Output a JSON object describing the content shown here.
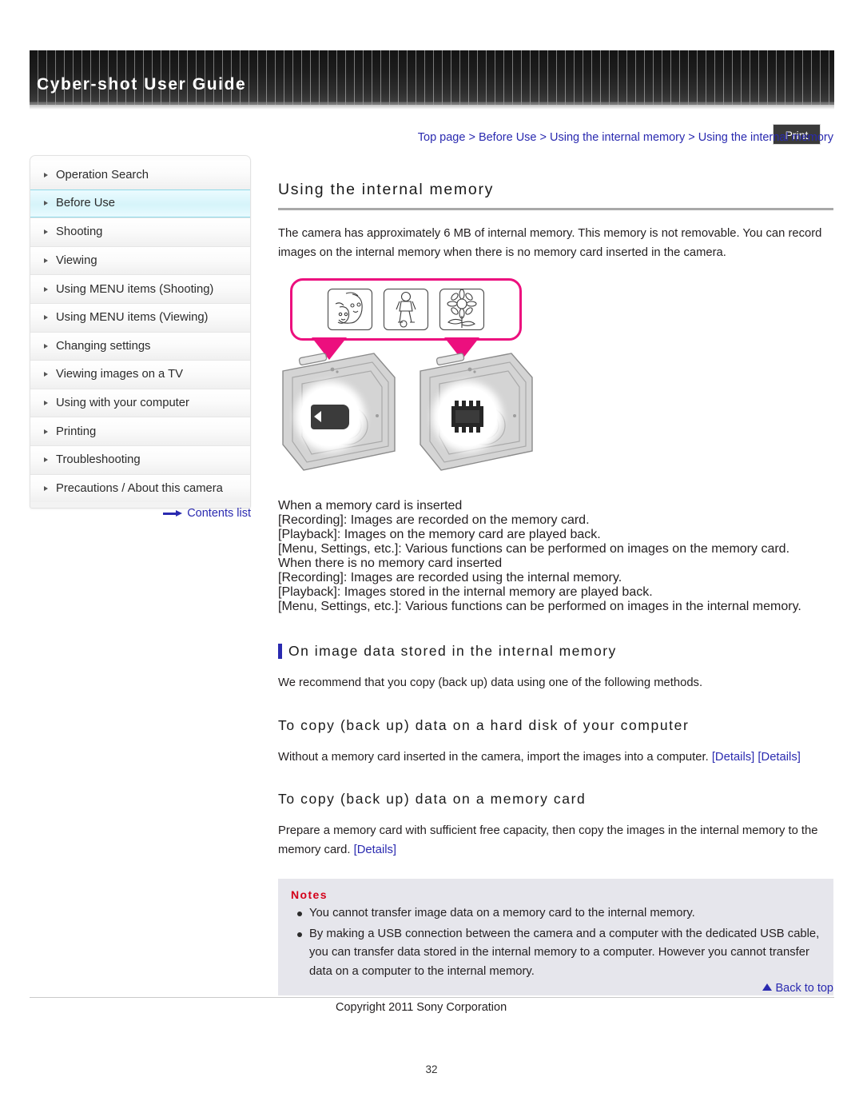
{
  "header": {
    "title": "Cyber-shot User Guide",
    "print_label": "Print"
  },
  "breadcrumb": {
    "text": "Top page > Before Use > Using the internal memory > Using the internal memory"
  },
  "sidebar": {
    "items": [
      {
        "label": "Operation Search",
        "selected": false
      },
      {
        "label": "Before Use",
        "selected": true
      },
      {
        "label": "Shooting",
        "selected": false
      },
      {
        "label": "Viewing",
        "selected": false
      },
      {
        "label": "Using MENU items (Shooting)",
        "selected": false
      },
      {
        "label": "Using MENU items (Viewing)",
        "selected": false
      },
      {
        "label": "Changing settings",
        "selected": false
      },
      {
        "label": "Viewing images on a TV",
        "selected": false
      },
      {
        "label": "Using with your computer",
        "selected": false
      },
      {
        "label": "Printing",
        "selected": false
      },
      {
        "label": "Troubleshooting",
        "selected": false
      },
      {
        "label": "Precautions / About this camera",
        "selected": false
      }
    ],
    "contents_link": "Contents list"
  },
  "main": {
    "page_title": "Using the internal memory",
    "intro": "The camera has approximately 6 MB of internal memory. This memory is not removable. You can record images on the internal memory when there is no memory card inserted in the camera.",
    "figure": {
      "thumbnails": [
        "portrait-thumbnail",
        "soccer-player-thumbnail",
        "flower-thumbnail"
      ],
      "left_camera_icon": "memory-card-icon",
      "right_camera_icon": "internal-memory-chip-icon"
    },
    "card_block": [
      "When a memory card is inserted",
      "[Recording]: Images are recorded on the memory card.",
      "[Playback]: Images on the memory card are played back.",
      "[Menu, Settings, etc.]: Various functions can be performed on images on the memory card.",
      "When there is no memory card inserted",
      "[Recording]: Images are recorded using the internal memory.",
      "[Playback]: Images stored in the internal memory are played back.",
      "[Menu, Settings, etc.]: Various functions can be performed on images in the internal memory."
    ],
    "section1": {
      "heading": "On image data stored in the internal memory",
      "body": "We recommend that you copy (back up) data using one of the following methods."
    },
    "section2": {
      "heading": "To copy (back up) data on a hard disk of your computer",
      "body": "Without a memory card inserted in the camera, import the images into a computer.",
      "link1": "[Details]",
      "link2": "[Details]"
    },
    "section3": {
      "heading": "To copy (back up) data on a memory card",
      "body_part1": "Prepare a memory card with sufficient free capacity, then copy the images in the internal memory to the memory card.",
      "link": "[Details]"
    },
    "notes": {
      "title": "Notes",
      "items": [
        "You cannot transfer image data on a memory card to the internal memory.",
        "By making a USB connection between the camera and a computer with the dedicated USB cable, you can transfer data stored in the internal memory to a computer. However you cannot transfer data on a computer to the internal memory."
      ]
    }
  },
  "footer": {
    "back_to_top": "Back to top",
    "copyright": "Copyright 2011 Sony Corporation",
    "page_number": "32"
  },
  "colors": {
    "link": "#2a2ab0",
    "accent_pink": "#ec0f7e",
    "notes_title": "#d4001a",
    "selected_nav": "#d6f4fa"
  }
}
